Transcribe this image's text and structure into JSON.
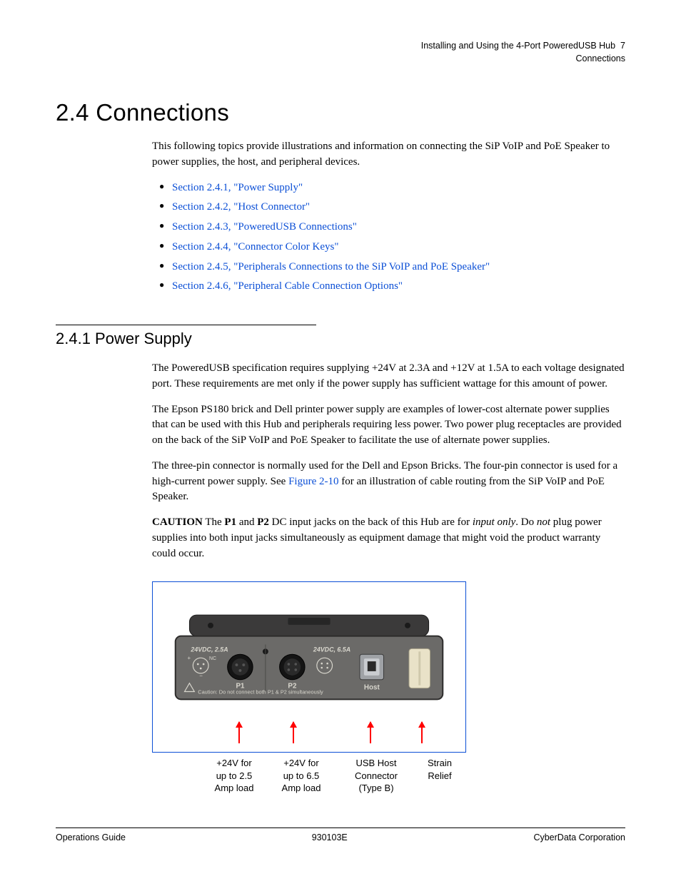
{
  "header": {
    "line1_prefix": "Installing and Using the 4-Port PoweredUSB Hub",
    "page_number": "7",
    "line2": "Connections"
  },
  "section": {
    "number_title": "2.4 Connections",
    "intro": "This following topics provide illustrations and information on connecting the SiP VoIP and PoE Speaker to power supplies, the host, and peripheral devices.",
    "links": [
      "Section 2.4.1, \"Power Supply\"",
      "Section 2.4.2, \"Host Connector\"",
      "Section 2.4.3, \"PoweredUSB Connections\"",
      "Section 2.4.4, \"Connector Color Keys\"",
      "Section 2.4.5, \"Peripherals Connections to the SiP VoIP and PoE Speaker\"",
      "Section 2.4.6, \"Peripheral Cable Connection Options\""
    ]
  },
  "subsection": {
    "title": "2.4.1 Power Supply",
    "p1": "The PoweredUSB specification requires supplying +24V at 2.3A and +12V at 1.5A to each voltage designated port. These requirements are met only if the power supply has sufficient wattage for this amount of power.",
    "p2": "The Epson PS180 brick and Dell printer power supply are examples of lower-cost alternate power supplies that can be used with this Hub and peripherals requiring less power. Two power plug receptacles are provided on the back of the SiP VoIP and PoE Speaker to facilitate the use of alternate power supplies.",
    "p3_a": "The three-pin connector is normally used for the Dell and Epson Bricks. The four-pin connector is used for a high-current power supply. See ",
    "p3_link": "Figure 2-10",
    "p3_b": " for an illustration of cable routing from the SiP VoIP and PoE Speaker.",
    "caution_label": "CAUTION",
    "caution_a": "   The ",
    "caution_p1": "P1",
    "caution_mid": " and ",
    "caution_p2": "P2",
    "caution_b": " DC input jacks on the back of this Hub are for ",
    "caution_italic1": "input only",
    "caution_c": ". Do ",
    "caution_italic2": "not",
    "caution_d": " plug power supplies into both input jacks simultaneously as equipment damage that might void the product warranty could occur."
  },
  "figure": {
    "labels_on_device": {
      "left_rating": "24VDC, 2.5A",
      "right_rating": "24VDC, 6.5A",
      "p1": "P1",
      "p2": "P2",
      "host": "Host",
      "warning": "Caution: Do not connect both P1 & P2 simultaneously",
      "nc": "NC"
    },
    "callouts": [
      "+24V for\nup to 2.5\nAmp load",
      "+24V for\nup to 6.5\nAmp load",
      "USB Host\nConnector\n(Type B)",
      "Strain\nRelief"
    ]
  },
  "footer": {
    "left": "Operations Guide",
    "center": "930103E",
    "right": "CyberData Corporation"
  }
}
